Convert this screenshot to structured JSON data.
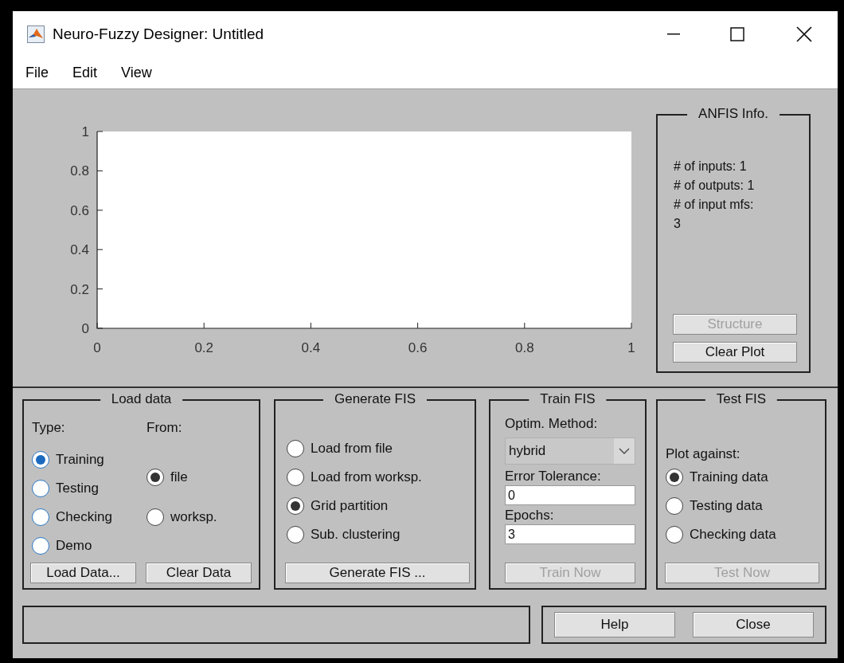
{
  "window": {
    "title": "Neuro-Fuzzy Designer: Untitled"
  },
  "menu": [
    "File",
    "Edit",
    "View"
  ],
  "plot": {
    "chart_data": {
      "type": "line",
      "xlim": [
        0,
        1
      ],
      "ylim": [
        0,
        1
      ],
      "xticks": [
        0,
        0.2,
        0.4,
        0.6,
        0.8,
        1
      ],
      "yticks": [
        0,
        0.2,
        0.4,
        0.6,
        0.8,
        1
      ]
    }
  },
  "anfis_info": {
    "title": "ANFIS Info.",
    "lines": [
      "# of inputs: 1",
      "# of outputs: 1",
      "# of input mfs:",
      "3"
    ],
    "buttons": [
      {
        "label": "Structure",
        "disabled": true
      },
      {
        "label": "Clear Plot",
        "disabled": false
      }
    ]
  },
  "load_data": {
    "title": "Load data",
    "type_label": "Type:",
    "from_label": "From:",
    "type_options": [
      {
        "label": "Training",
        "selected": true
      },
      {
        "label": "Testing",
        "selected": false
      },
      {
        "label": "Checking",
        "selected": false
      },
      {
        "label": "Demo",
        "selected": false
      }
    ],
    "from_options": [
      {
        "label": "file",
        "selected": true
      },
      {
        "label": "worksp.",
        "selected": false
      }
    ],
    "buttons": [
      {
        "label": "Load Data...",
        "disabled": false
      },
      {
        "label": "Clear Data",
        "disabled": false
      }
    ]
  },
  "generate_fis": {
    "title": "Generate FIS",
    "options": [
      {
        "label": "Load from file",
        "selected": false
      },
      {
        "label": "Load from worksp.",
        "selected": false
      },
      {
        "label": "Grid partition",
        "selected": true
      },
      {
        "label": "Sub. clustering",
        "selected": false
      }
    ],
    "button": {
      "label": "Generate FIS ...",
      "disabled": false
    }
  },
  "train_fis": {
    "title": "Train FIS",
    "method_label": "Optim. Method:",
    "method": "hybrid",
    "tolerance_label": "Error Tolerance:",
    "tolerance": "0",
    "epochs_label": "Epochs:",
    "epochs": "3",
    "button": {
      "label": "Train Now",
      "disabled": true
    }
  },
  "test_fis": {
    "title": "Test FIS",
    "plot_against_label": "Plot against:",
    "options": [
      {
        "label": "Training data",
        "selected": true
      },
      {
        "label": "Testing data",
        "selected": false
      },
      {
        "label": "Checking data",
        "selected": false
      }
    ],
    "button": {
      "label": "Test Now",
      "disabled": true
    }
  },
  "bottom_buttons": [
    {
      "label": "Help",
      "disabled": false
    },
    {
      "label": "Close",
      "disabled": false
    }
  ]
}
